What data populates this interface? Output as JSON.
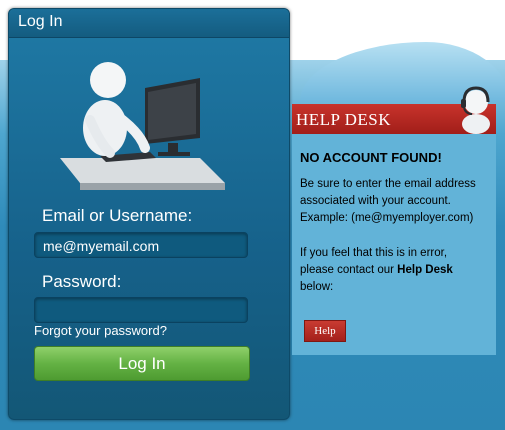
{
  "login": {
    "title": "Log In",
    "email_label": "Email or Username:",
    "email_value": "me@myemail.com",
    "password_label": "Password:",
    "password_value": "",
    "forgot_link": "Forgot your password?",
    "submit_label": "Log In"
  },
  "help": {
    "banner_title": "HELP DESK",
    "heading": "NO ACCOUNT FOUND!",
    "line1": "Be sure to enter the email address",
    "line2": "associated with your account.",
    "line3": "Example: (me@myemployer.com)",
    "line4": "If you feel that this is in error,",
    "line5_pre": "please contact our ",
    "line5_bold": "Help Desk",
    "line6": "below:",
    "button_label": "Help"
  },
  "colors": {
    "panel_blue": "#1f7aa6",
    "login_button_green": "#64b244",
    "help_red": "#b1271f",
    "help_panel_blue": "#62b3d8"
  },
  "icons": [
    "computer-user-illustration",
    "headset-person-icon"
  ]
}
